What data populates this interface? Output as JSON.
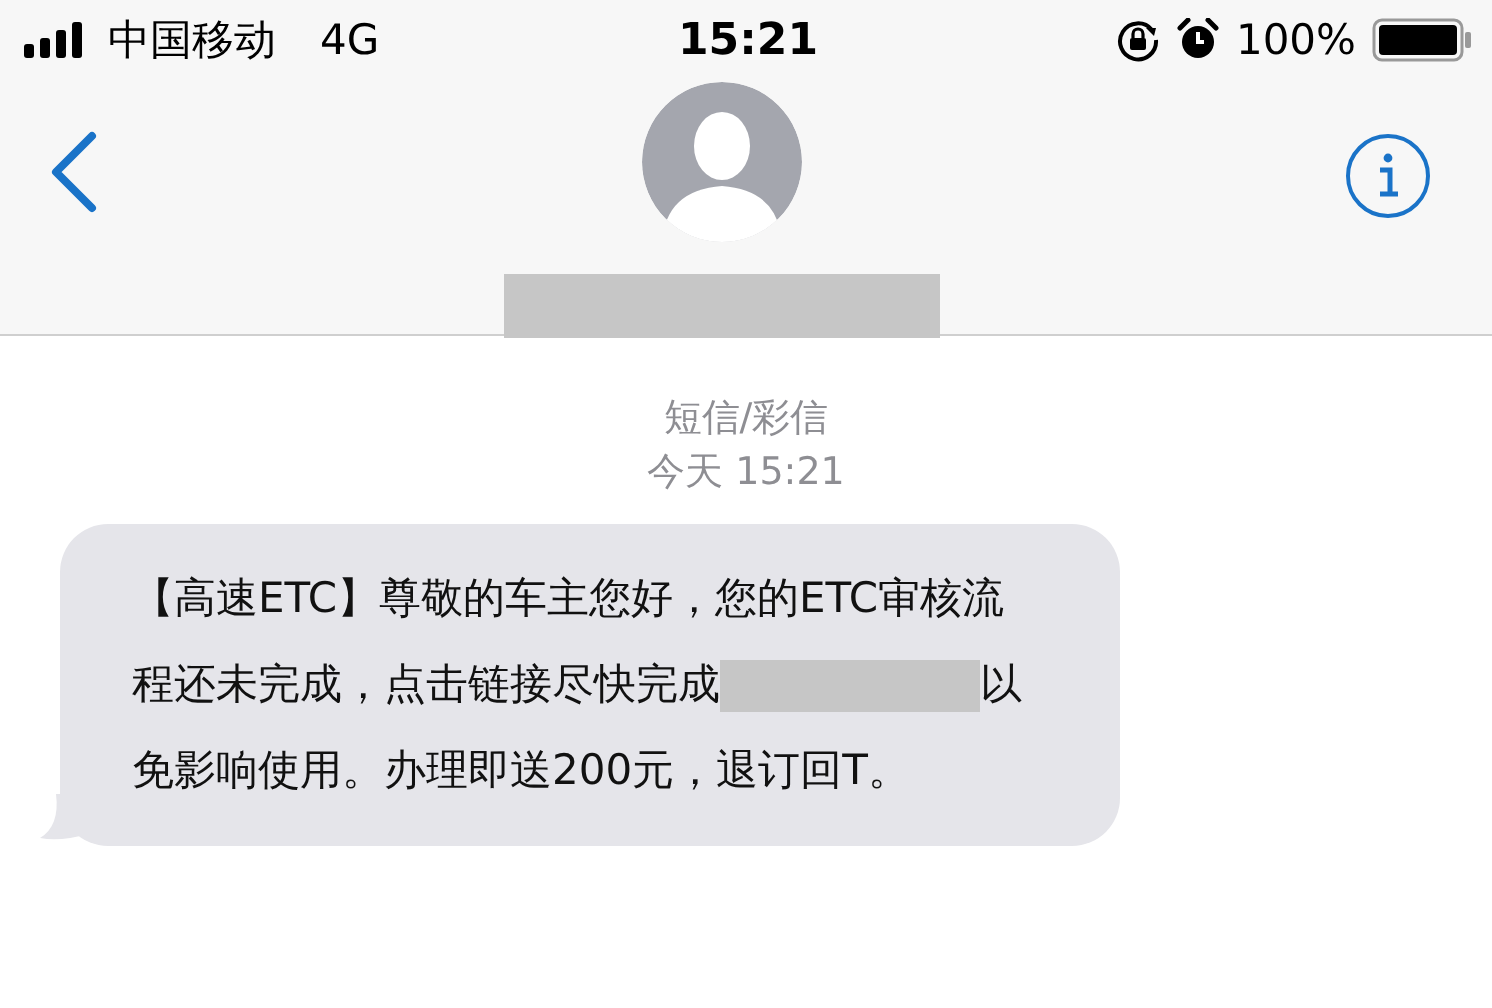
{
  "status_bar": {
    "carrier": "中国移动",
    "network": "4G",
    "time": "15:21",
    "battery_percent": "100%"
  },
  "nav": {
    "contact_name": {
      "kind": "redacted"
    }
  },
  "thread": {
    "service": "短信/彩信",
    "timestamp": "今天 15:21"
  },
  "message": {
    "lines": [
      [
        {
          "kind": "text",
          "text": "【高速ETC】尊敬的车主您好，您的ETC审核流"
        }
      ],
      [
        {
          "kind": "text",
          "text": "程还未完成，点击链接尽快完成"
        },
        {
          "kind": "redacted"
        },
        {
          "kind": "text",
          "text": "以"
        }
      ],
      [
        {
          "kind": "text",
          "text": "免影响使用。办理即送200元，退订回T。"
        }
      ]
    ]
  }
}
